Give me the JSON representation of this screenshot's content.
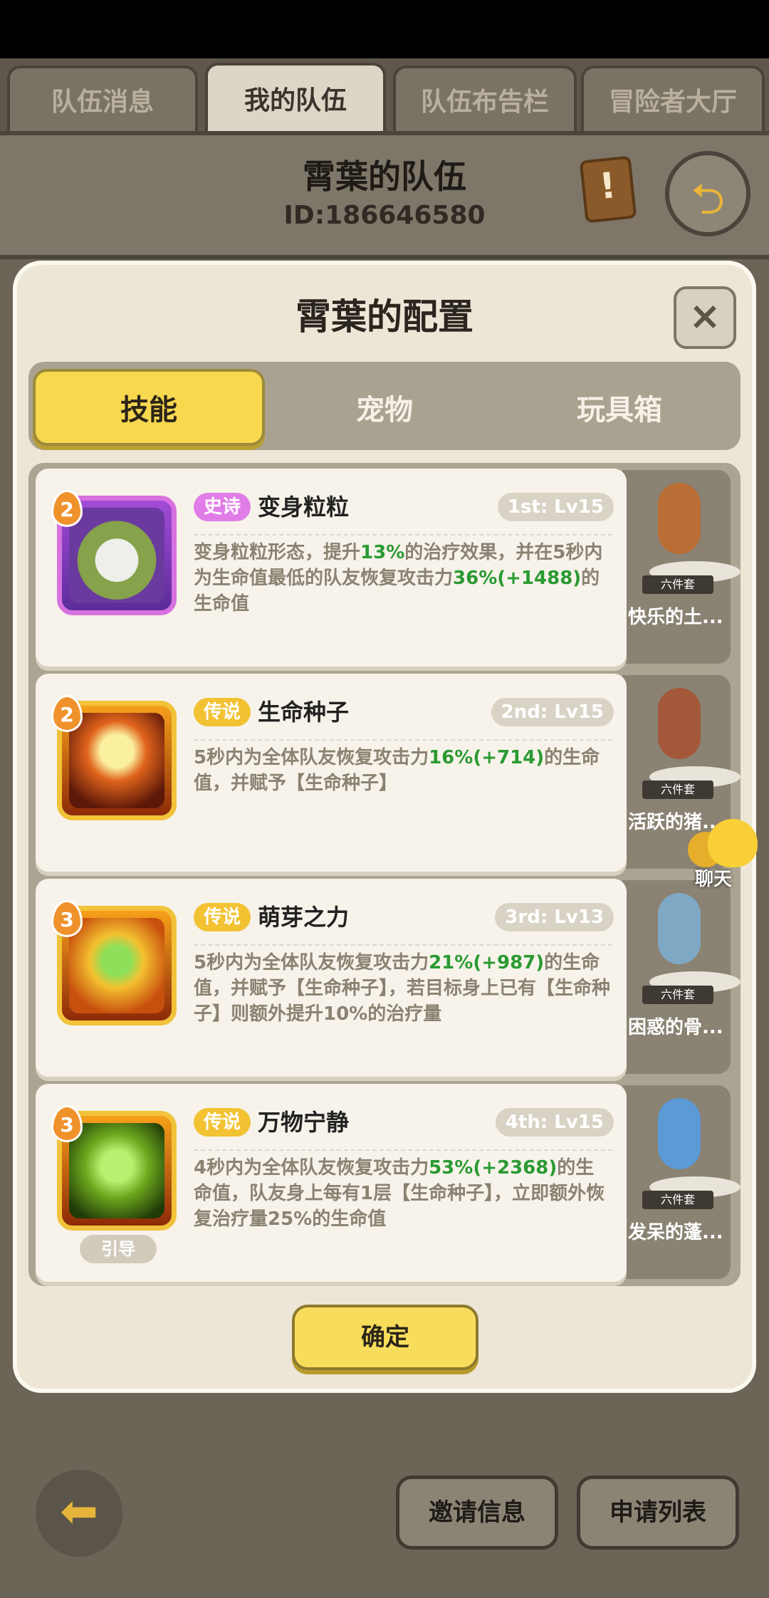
{
  "top_tabs": [
    {
      "label": "队伍消息",
      "active": false
    },
    {
      "label": "我的队伍",
      "active": true
    },
    {
      "label": "队伍布告栏",
      "active": false
    },
    {
      "label": "冒险者大厅",
      "active": false
    }
  ],
  "team": {
    "name": "霄葉的队伍",
    "id": "ID:186646580"
  },
  "dialog": {
    "title": "霄葉的配置",
    "close_label": "×",
    "tabs": [
      "技能",
      "宠物",
      "玩具箱"
    ],
    "active_tab": "技能",
    "confirm_label": "确定"
  },
  "skills": [
    {
      "level": "2",
      "rarity": "史诗",
      "name": "变身粒粒",
      "slot": "1st: Lv15",
      "desc": [
        "变身粒粒形态，提升",
        "13%",
        "的治疗效果，并在5秒内为生命值最低的队友恢复攻击力",
        "36%(+1488)",
        "的生命值"
      ]
    },
    {
      "level": "2",
      "rarity": "传说",
      "name": "生命种子",
      "slot": "2nd: Lv15",
      "desc": [
        "5秒内为全体队友恢复攻击力",
        "16%(+714)",
        "的生命值，并赋予【生命种子】",
        "",
        ""
      ]
    },
    {
      "level": "3",
      "rarity": "传说",
      "name": "萌芽之力",
      "slot": "3rd: Lv13",
      "desc": [
        "5秒内为全体队友恢复攻击力",
        "21%(+987)",
        "的生命值，并赋予【生命种子】，若目标身上已有【生命种子】则额外提升10%的治疗量",
        "",
        ""
      ]
    },
    {
      "level": "3",
      "rarity": "传说",
      "name": "万物宁静",
      "slot": "4th: Lv15",
      "tag": "引导",
      "desc": [
        "4秒内为全体队友恢复攻击力",
        "53%(+2368)",
        "的生命值，队友身上每有1层【生命种子】，立即额外恢复治疗量25%的生命值",
        "",
        ""
      ]
    }
  ],
  "pets": [
    {
      "tag": "六件套",
      "name": "快乐的土..."
    },
    {
      "tag": "六件套",
      "name": "活跃的猪..."
    },
    {
      "tag": "六件套",
      "name": "困惑的骨..."
    },
    {
      "tag": "六件套",
      "name": "发呆的蓬..."
    }
  ],
  "chat": {
    "label": "聊天"
  },
  "bottom": {
    "invite_label": "邀请信息",
    "apply_label": "申请列表"
  }
}
